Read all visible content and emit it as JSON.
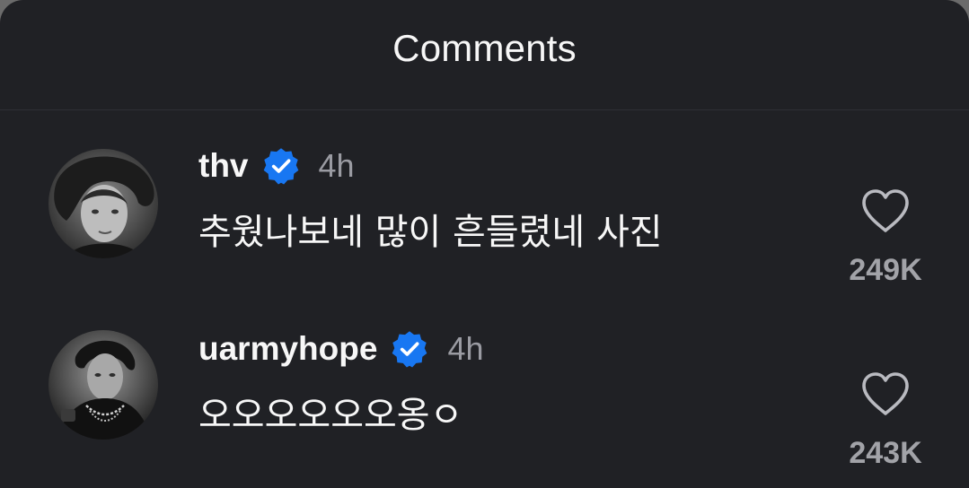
{
  "header": {
    "title": "Comments"
  },
  "colors": {
    "background": "#202125",
    "verified_badge": "#1877f2",
    "muted_text": "#9a9ba2"
  },
  "comments": [
    {
      "username": "thv",
      "verified": true,
      "time": "4h",
      "text": "추웠나보네 많이 흔들렸네 사진",
      "likes": "249K",
      "avatar_icon": "profile-photo"
    },
    {
      "username": "uarmyhope",
      "verified": true,
      "time": "4h",
      "text": "오오오오오오옹ㅇ",
      "likes": "243K",
      "avatar_icon": "profile-photo"
    }
  ]
}
